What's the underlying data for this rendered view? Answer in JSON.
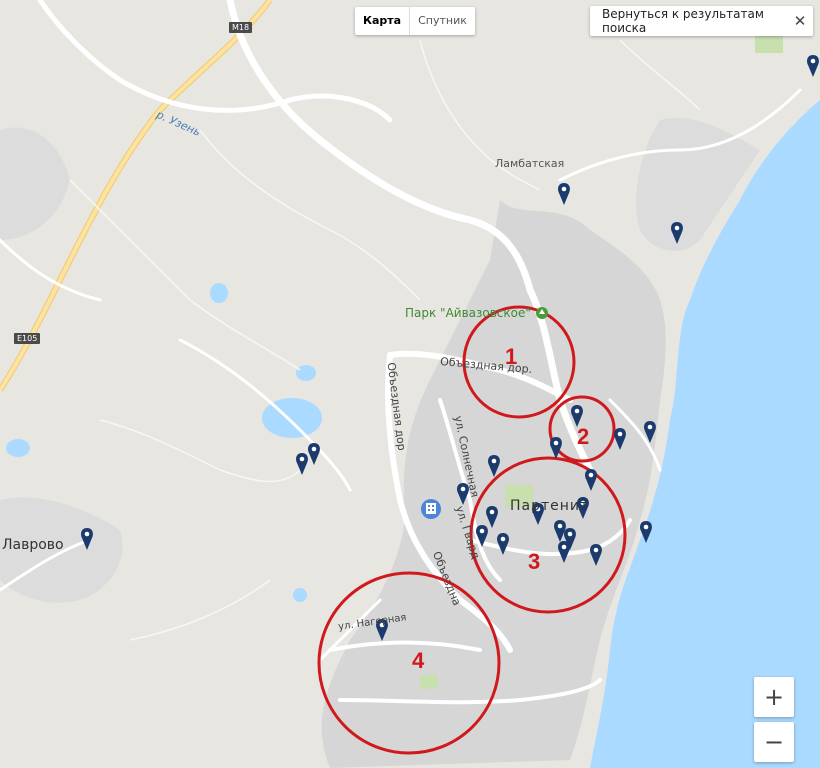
{
  "map_controls": {
    "map_tab": "Карта",
    "satellite_tab": "Спутник",
    "back_button": "Вернуться к результатам поиска",
    "zoom_in": "+",
    "zoom_out": "−"
  },
  "labels": {
    "river": "р. Узень",
    "lambatskaya": "Ламбатская",
    "park": "Парк \"Айвазовское\"",
    "obezdnaya_h": "Объездная дор.",
    "obezdnaya_v": "Объездная дор",
    "obezdnaya_v2": "Объездна",
    "solnechnaya": "ул. Солнечная",
    "partenit": "Партенит",
    "gvardii": "ул. Гвард",
    "nagornaya": "ул. Нагорная",
    "lavrovoe": "Лаврово",
    "m18": "M18",
    "e105": "E105"
  },
  "annotations": [
    "1",
    "2",
    "3",
    "4"
  ],
  "colors": {
    "land": "#e8e6e1",
    "town": "#d4d4d4",
    "sea": "#aadaff",
    "road": "#ffffff",
    "highway": "#f9dd8b",
    "pin": "#1b3a6e",
    "annotation": "#d0191c",
    "water_lake": "#aadaff",
    "park_green": "#c8dfae"
  }
}
